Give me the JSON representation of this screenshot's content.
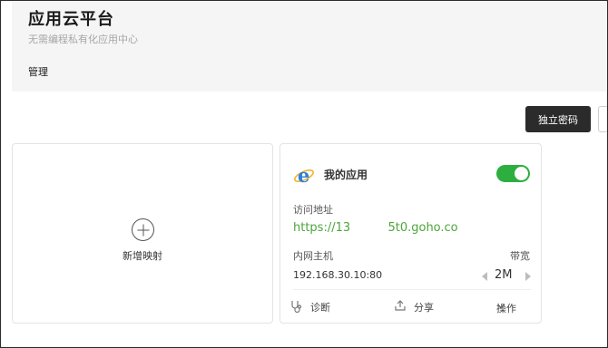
{
  "header": {
    "title": "应用云平台",
    "subtitle": "无需编程私有化应用中心",
    "tabs": [
      "管理"
    ]
  },
  "toolbar": {
    "independent_password_label": "独立密码"
  },
  "add_card": {
    "label": "新增映射"
  },
  "app_card": {
    "name": "我的应用",
    "enabled": true,
    "access_address_label": "访问地址",
    "url": "https://13          5t0.goho.co",
    "host_label": "内网主机",
    "host_value": "192.168.30.10:80",
    "bandwidth_label": "带宽",
    "bandwidth_value": "2M",
    "actions": {
      "diagnose": "诊断",
      "share": "分享",
      "operations": "操作"
    }
  },
  "colors": {
    "accent_green": "#2daf3f",
    "url_green": "#4ca53a",
    "dark_button": "#2b2b2b",
    "header_bg": "#f5f5f5"
  },
  "icons": {
    "app": "ie-e-icon",
    "add": "plus-circle-icon",
    "diagnose": "diagnose-icon",
    "share": "upload-share-icon",
    "operations": "chevron-down-icon",
    "bandwidth_prev": "caret-left-icon",
    "bandwidth_next": "caret-right-icon"
  }
}
